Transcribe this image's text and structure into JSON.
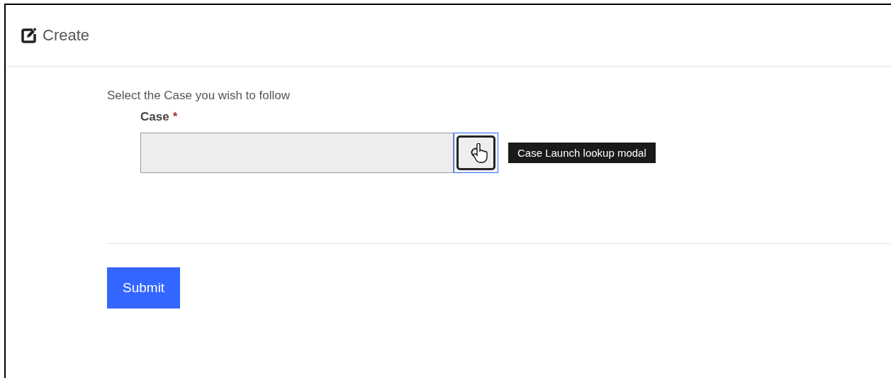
{
  "header": {
    "title": "Create"
  },
  "form": {
    "instructions": "Select the Case you wish to follow",
    "field": {
      "label": "Case",
      "required_mark": "*",
      "lookup_button": {
        "focused": true
      },
      "tooltip": "Case Launch lookup modal"
    }
  },
  "buttons": [
    {
      "label": "Submit",
      "kind": "primary"
    }
  ]
}
